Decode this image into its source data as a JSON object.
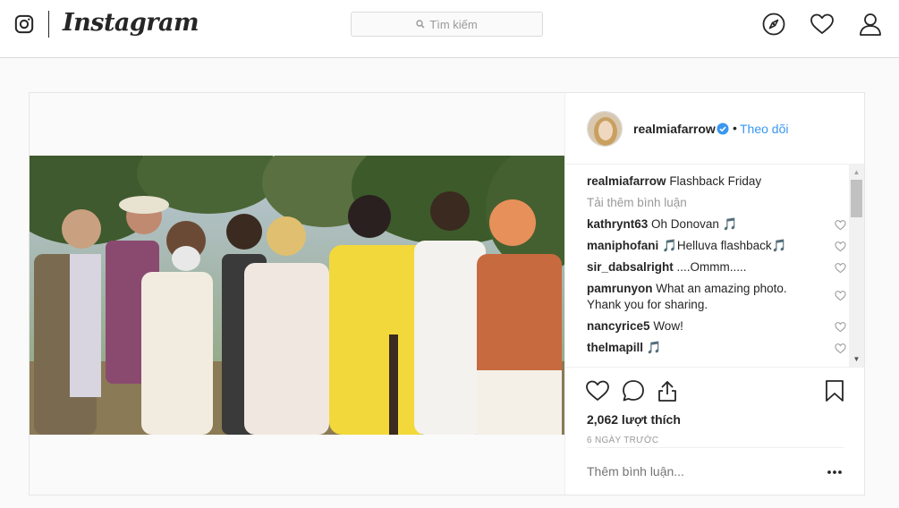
{
  "nav": {
    "brand": "Instagram",
    "search_placeholder": "Tìm kiếm",
    "icons": [
      "instagram-logo-icon",
      "explore-compass-icon",
      "activity-heart-icon",
      "profile-user-icon"
    ]
  },
  "post": {
    "username": "realmiafarrow",
    "verified": true,
    "separator": "•",
    "follow_label": "Theo dõi",
    "caption": {
      "user": "realmiafarrow",
      "text": "Flashback Friday"
    },
    "load_more_label": "Tải thêm bình luận",
    "comments": [
      {
        "user": "kathrynt63",
        "text": "Oh Donovan 🎵"
      },
      {
        "user": "maniphofani",
        "text": "🎵Helluva flashback🎵"
      },
      {
        "user": "sir_dabsalright",
        "text": "....Ommm....."
      },
      {
        "user": "pamrunyon",
        "text": "What an amazing photo. Yhank you for sharing."
      },
      {
        "user": "nancyrice5",
        "text": "Wow!"
      },
      {
        "user": "thelmapill",
        "text": "🎵"
      }
    ],
    "likes_label": "2,062 lượt thích",
    "time_label": "6 NGÀY TRƯỚC",
    "add_comment_placeholder": "Thêm bình luận..."
  },
  "colors": {
    "link_blue": "#3897f0",
    "verified_blue": "#3897f0",
    "muted": "#999999",
    "border": "#dbdbdb"
  }
}
